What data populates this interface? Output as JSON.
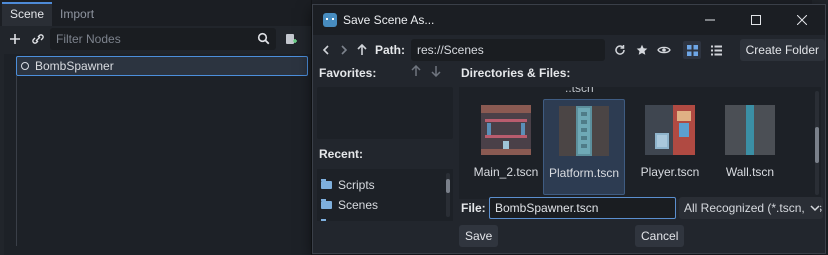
{
  "scene_dock": {
    "tabs": [
      "Scene",
      "Import"
    ],
    "filter_placeholder": "Filter Nodes",
    "root_node": "BombSpawner"
  },
  "dialog": {
    "title": "Save Scene As...",
    "path_label": "Path:",
    "path_value": "res://Scenes",
    "create_folder_label": "Create Folder",
    "favorites_label": "Favorites:",
    "recent_label": "Recent:",
    "recent_items": [
      "Scripts",
      "Scenes"
    ],
    "directories_label": "Directories & Files:",
    "clipped_text": "..tscn",
    "files": [
      {
        "name": "Main_2.tscn",
        "selected": false
      },
      {
        "name": "Platform.tscn",
        "selected": true
      },
      {
        "name": "Player.tscn",
        "selected": false
      },
      {
        "name": "Wall.tscn",
        "selected": false
      }
    ],
    "file_label": "File:",
    "file_value": "BombSpawner.tscn",
    "filter_value": "All Recognized (*.tscn, *.s",
    "save_label": "Save",
    "cancel_label": "Cancel"
  },
  "colors": {
    "accent": "#4e8bd8",
    "selection_bg": "#2d3c52",
    "panel_bg": "#22262d"
  }
}
